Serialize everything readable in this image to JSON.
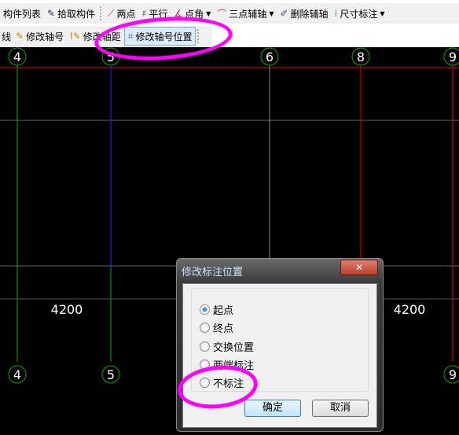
{
  "toolbar1": {
    "items": [
      {
        "label": "构件列表",
        "icon": "list-icon"
      },
      {
        "label": "拾取构件",
        "icon": "picker-icon"
      },
      {
        "label": "两点",
        "icon": "two-point-axis-icon"
      },
      {
        "label": "平行",
        "icon": "parallel-axis-icon"
      },
      {
        "label": "点角",
        "icon": "point-angle-icon"
      },
      {
        "label": "三点辅轴",
        "icon": "three-point-arc-icon"
      },
      {
        "label": "删除辅轴",
        "icon": "eraser-icon"
      },
      {
        "label": "尺寸标注",
        "icon": "dimension-icon"
      }
    ]
  },
  "toolbar2": {
    "items": [
      {
        "label": "线"
      },
      {
        "label": "修改轴号",
        "icon": "edit-axis-number-icon"
      },
      {
        "label": "修改轴距",
        "icon": "edit-axis-spacing-icon"
      },
      {
        "label": "修改轴号位置",
        "icon": "edit-axis-position-icon",
        "active": true
      }
    ]
  },
  "canvas": {
    "top_axes": [
      "4",
      "5",
      "6",
      "8",
      "9"
    ],
    "bottom_axes": [
      "4",
      "5",
      "9"
    ],
    "dimensions": [
      "4200",
      "4200"
    ]
  },
  "dialog": {
    "title": "修改标注位置",
    "close": "✕",
    "options": [
      {
        "label": "起点",
        "selected": true
      },
      {
        "label": "终点",
        "selected": false
      },
      {
        "label": "交换位置",
        "selected": false
      },
      {
        "label": "两端标注",
        "selected": false
      },
      {
        "label": "不标注",
        "selected": false
      }
    ],
    "ok": "确定",
    "cancel": "取消"
  },
  "colors": {
    "highlight": "#ff00ff",
    "axis_red": "#ff0000",
    "axis_green": "#00a000",
    "axis_blue": "#0000ff"
  }
}
